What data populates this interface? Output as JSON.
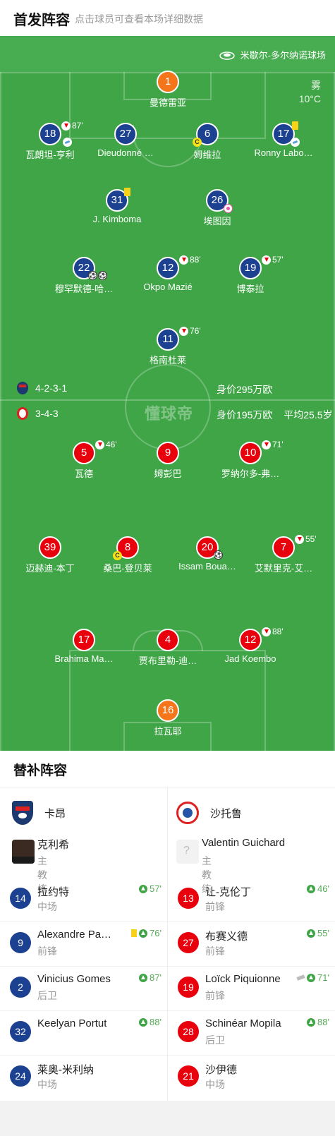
{
  "header": {
    "title": "首发阵容",
    "subtitle": "点击球员可查看本场详细数据"
  },
  "pitch": {
    "venue": "米歇尔-多尔纳诺球场",
    "weather": "雾",
    "temperature": "10°C",
    "watermark": "懂球帝",
    "home_formation": "4-2-3-1",
    "home_value": "身价295万欧",
    "away_formation": "3-4-3",
    "away_value": "身价195万欧",
    "away_avg_age": "平均25.5岁"
  },
  "home_players": [
    {
      "number": "1",
      "name": "曼德雷亚"
    },
    {
      "number": "18",
      "name": "瓦朗坦-亨利",
      "sub_minute": "87'"
    },
    {
      "number": "27",
      "name": "Dieudonné …"
    },
    {
      "number": "6",
      "name": "姆维拉"
    },
    {
      "number": "17",
      "name": "Ronny Labo…"
    },
    {
      "number": "31",
      "name": "J. Kimboma"
    },
    {
      "number": "26",
      "name": "埃图因"
    },
    {
      "number": "22",
      "name": "穆罕默德-哈…"
    },
    {
      "number": "12",
      "name": "Okpo Mazié",
      "sub_minute": "88'"
    },
    {
      "number": "19",
      "name": "博泰拉",
      "sub_minute": "57'"
    },
    {
      "number": "11",
      "name": "格南杜莱",
      "sub_minute": "76'"
    }
  ],
  "away_players": [
    {
      "number": "5",
      "name": "瓦德",
      "sub_minute": "46'"
    },
    {
      "number": "9",
      "name": "姆彭巴"
    },
    {
      "number": "10",
      "name": "罗纳尔多-弗…",
      "sub_minute": "71'"
    },
    {
      "number": "39",
      "name": "迈赫迪-本丁"
    },
    {
      "number": "8",
      "name": "桑巴-登贝莱"
    },
    {
      "number": "20",
      "name": "Issam Boua…"
    },
    {
      "number": "7",
      "name": "艾默里克-艾…",
      "sub_minute": "55'"
    },
    {
      "number": "17",
      "name": "Brahima Ma…"
    },
    {
      "number": "4",
      "name": "贾布里勒-迪…"
    },
    {
      "number": "12",
      "name": "Jad Koembo",
      "sub_minute": "88'"
    },
    {
      "number": "16",
      "name": "拉瓦耶"
    }
  ],
  "subs": {
    "title": "替补阵容",
    "home_team": "卡昂",
    "away_team": "沙托鲁",
    "home_coach": {
      "name": "克利希",
      "role": "主教练"
    },
    "away_coach": {
      "name": "Valentin Guichard",
      "role": "主教练"
    },
    "home": [
      {
        "number": "14",
        "name": "拉约特",
        "position": "中场",
        "minute": "57'"
      },
      {
        "number": "9",
        "name": "Alexandre Pa…",
        "position": "前锋",
        "minute": "76'"
      },
      {
        "number": "2",
        "name": "Vinicius Gomes",
        "position": "后卫",
        "minute": "87'"
      },
      {
        "number": "32",
        "name": "Keelyan Portut",
        "position": "",
        "minute": "88'"
      },
      {
        "number": "24",
        "name": "莱奥-米利纳",
        "position": "中场",
        "minute": ""
      }
    ],
    "away": [
      {
        "number": "13",
        "name": "让-克伦丁",
        "position": "前锋",
        "minute": "46'"
      },
      {
        "number": "27",
        "name": "布赛义德",
        "position": "前锋",
        "minute": "55'"
      },
      {
        "number": "19",
        "name": "Loïck Piquionne",
        "position": "前锋",
        "minute": "71'"
      },
      {
        "number": "28",
        "name": "Schinéar Mopila",
        "position": "后卫",
        "minute": "88'"
      },
      {
        "number": "21",
        "name": "沙伊德",
        "position": "中场",
        "minute": ""
      }
    ]
  },
  "colors": {
    "pitch": "#3fa547",
    "home": "#1d4191",
    "away": "#e8000d",
    "goalkeeper": "#f5761a"
  },
  "icons": [
    "stadium-icon",
    "sub-off-icon",
    "sub-on-icon",
    "yellow-card-icon",
    "captain-icon",
    "goal-icon",
    "assist-icon",
    "own-goal-icon",
    "team-crest-icon"
  ]
}
